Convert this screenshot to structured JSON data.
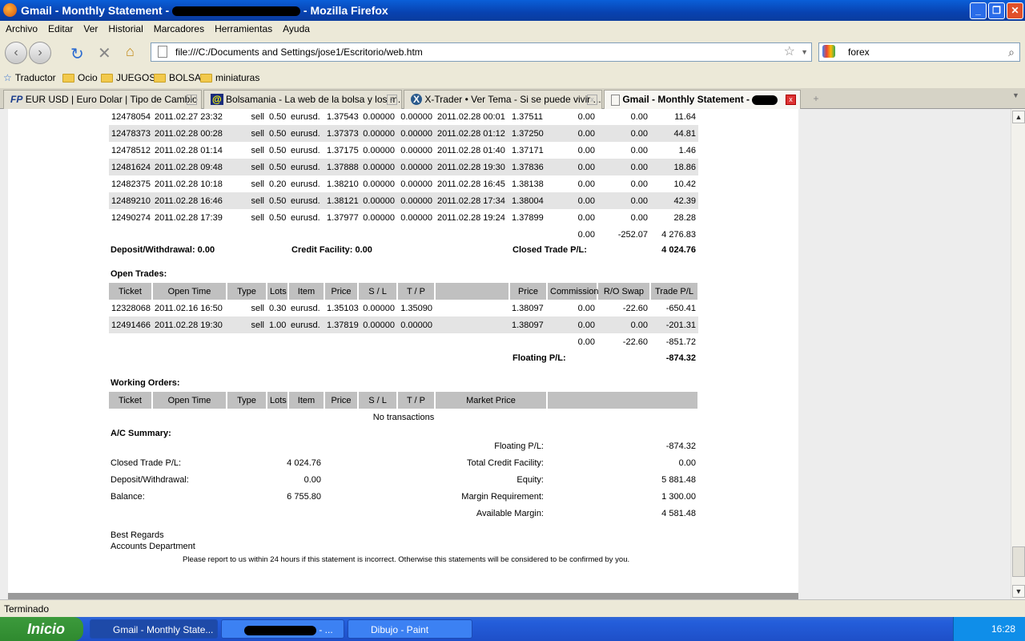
{
  "window": {
    "title_prefix": "Gmail - Monthly Statement -",
    "title_suffix": "- Mozilla Firefox",
    "minimize": "_",
    "restore": "❐",
    "close": "✕"
  },
  "menu": [
    "Archivo",
    "Editar",
    "Ver",
    "Historial",
    "Marcadores",
    "Herramientas",
    "Ayuda"
  ],
  "nav": {
    "url": "file:///C:/Documents and Settings/jose1/Escritorio/web.htm",
    "search": "forex"
  },
  "bookmarks": [
    "Traductor",
    "Ocio",
    "JUEGOS",
    "BOLSA",
    "miniaturas"
  ],
  "tabs": [
    {
      "label": "EUR USD | Euro Dolar | Tipo de Cambio ...",
      "icon": "FP"
    },
    {
      "label": "Bolsamania - La web de la bolsa y los m...",
      "icon": "@"
    },
    {
      "label": "X-Trader • Ver Tema - Si se puede vivir ...",
      "icon": "X"
    },
    {
      "label": "Gmail - Monthly Statement -",
      "icon": "page"
    }
  ],
  "closed_trades": {
    "rows": [
      [
        "12478054",
        "2011.02.27 23:32",
        "sell",
        "0.50",
        "eurusd.",
        "1.37543",
        "0.00000",
        "0.00000",
        "2011.02.28 00:01",
        "1.37511",
        "0.00",
        "0.00",
        "11.64"
      ],
      [
        "12478373",
        "2011.02.28 00:28",
        "sell",
        "0.50",
        "eurusd.",
        "1.37373",
        "0.00000",
        "0.00000",
        "2011.02.28 01:12",
        "1.37250",
        "0.00",
        "0.00",
        "44.81"
      ],
      [
        "12478512",
        "2011.02.28 01:14",
        "sell",
        "0.50",
        "eurusd.",
        "1.37175",
        "0.00000",
        "0.00000",
        "2011.02.28 01:40",
        "1.37171",
        "0.00",
        "0.00",
        "1.46"
      ],
      [
        "12481624",
        "2011.02.28 09:48",
        "sell",
        "0.50",
        "eurusd.",
        "1.37888",
        "0.00000",
        "0.00000",
        "2011.02.28 19:30",
        "1.37836",
        "0.00",
        "0.00",
        "18.86"
      ],
      [
        "12482375",
        "2011.02.28 10:18",
        "sell",
        "0.20",
        "eurusd.",
        "1.38210",
        "0.00000",
        "0.00000",
        "2011.02.28 16:45",
        "1.38138",
        "0.00",
        "0.00",
        "10.42"
      ],
      [
        "12489210",
        "2011.02.28 16:46",
        "sell",
        "0.50",
        "eurusd.",
        "1.38121",
        "0.00000",
        "0.00000",
        "2011.02.28 17:34",
        "1.38004",
        "0.00",
        "0.00",
        "42.39"
      ],
      [
        "12490274",
        "2011.02.28 17:39",
        "sell",
        "0.50",
        "eurusd.",
        "1.37977",
        "0.00000",
        "0.00000",
        "2011.02.28 19:24",
        "1.37899",
        "0.00",
        "0.00",
        "28.28"
      ]
    ],
    "totals": [
      "0.00",
      "-252.07",
      "4 276.83"
    ],
    "deposit": "Deposit/Withdrawal: 0.00",
    "credit": "Credit Facility: 0.00",
    "closed_pl_label": "Closed Trade P/L:",
    "closed_pl": "4 024.76"
  },
  "open_trades": {
    "title": "Open Trades:",
    "headers": [
      "Ticket",
      "Open Time",
      "Type",
      "Lots",
      "Item",
      "Price",
      "S / L",
      "T / P",
      "",
      "Price",
      "Commission",
      "R/O Swap",
      "Trade P/L"
    ],
    "rows": [
      [
        "12328068",
        "2011.02.16 16:50",
        "sell",
        "0.30",
        "eurusd.",
        "1.35103",
        "0.00000",
        "1.35090",
        "",
        "1.38097",
        "0.00",
        "-22.60",
        "-650.41"
      ],
      [
        "12491466",
        "2011.02.28 19:30",
        "sell",
        "1.00",
        "eurusd.",
        "1.37819",
        "0.00000",
        "0.00000",
        "",
        "1.38097",
        "0.00",
        "0.00",
        "-201.31"
      ]
    ],
    "totals": [
      "0.00",
      "-22.60",
      "-851.72"
    ],
    "floating_label": "Floating P/L:",
    "floating": "-874.32"
  },
  "working_orders": {
    "title": "Working Orders:",
    "headers": [
      "Ticket",
      "Open Time",
      "Type",
      "Lots",
      "Item",
      "Price",
      "S / L",
      "T / P",
      "Market Price",
      ""
    ],
    "empty": "No transactions"
  },
  "summary": {
    "title": "A/C Summary:",
    "left": [
      [
        "Closed Trade P/L:",
        "4 024.76"
      ],
      [
        "Deposit/Withdrawal:",
        "0.00"
      ],
      [
        "Balance:",
        "6 755.80"
      ]
    ],
    "right": [
      [
        "Floating P/L:",
        "-874.32"
      ],
      [
        "Total Credit Facility:",
        "0.00"
      ],
      [
        "Equity:",
        "5 881.48"
      ],
      [
        "Margin Requirement:",
        "1 300.00"
      ],
      [
        "Available Margin:",
        "4 581.48"
      ]
    ]
  },
  "footer": {
    "regards": "Best Regards",
    "dept": "Accounts Department",
    "note": "Please report to us within 24 hours if this statement is incorrect. Otherwise this statements will be considered to be confirmed by you."
  },
  "status": "Terminado",
  "taskbar": {
    "start": "Inicio",
    "tasks": [
      "Gmail - Monthly State...",
      "- ...",
      "Dibujo - Paint"
    ],
    "clock": "16:28"
  }
}
